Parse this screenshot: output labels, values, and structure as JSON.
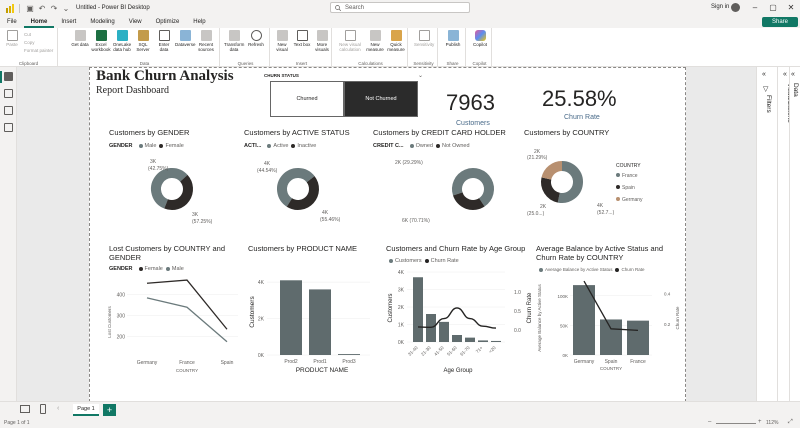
{
  "window": {
    "title": "Untitled - Power BI Desktop",
    "search_placeholder": "Search",
    "signin": "Sign in",
    "share": "Share"
  },
  "menu": [
    "File",
    "Home",
    "Insert",
    "Modeling",
    "View",
    "Optimize",
    "Help"
  ],
  "ribbon": {
    "clipboard": {
      "paste": "Paste",
      "cut": "Cut",
      "copy": "Copy",
      "format_painter": "Format painter",
      "label": "Clipboard"
    },
    "data": {
      "label": "Data",
      "buttons": [
        "Get data",
        "Excel workbook",
        "OneLake data hub",
        "SQL Server",
        "Enter data",
        "Dataverse",
        "Recent sources"
      ]
    },
    "queries": {
      "label": "Queries",
      "buttons": [
        "Transform data",
        "Refresh"
      ]
    },
    "insert": {
      "label": "Insert",
      "buttons": [
        "New visual",
        "Text box",
        "More visuals"
      ]
    },
    "calculations": {
      "label": "Calculations",
      "buttons": [
        "New visual calculation",
        "New measure",
        "Quick measure"
      ]
    },
    "sensitivity": {
      "label": "Sensitivity",
      "buttons": [
        "Sensitivity"
      ]
    },
    "share": {
      "label": "Share",
      "buttons": [
        "Publish"
      ]
    },
    "copilot": {
      "label": "Copilot",
      "buttons": [
        "Copilot"
      ]
    }
  },
  "report": {
    "title": "Bank Churn Analysis",
    "subtitle": "Report Dashboard",
    "slicer": {
      "label": "CHURN STATUS",
      "options": [
        "Churned",
        "Not Churned"
      ],
      "selected": "Not Churned"
    },
    "kpi_customers": {
      "value": "7963",
      "label": "Customers"
    },
    "kpi_churn": {
      "value": "25.58%",
      "label": "Churn Rate"
    }
  },
  "visuals": {
    "gender": {
      "title": "Customers by GENDER",
      "legend_title": "GENDER",
      "labels": [
        "3K",
        "(42.75%)",
        "3K",
        "(57.25%)"
      ]
    },
    "active": {
      "title": "Customers by ACTIVE STATUS",
      "legend_title": "ACTI...",
      "labels": [
        "4K",
        "(44.54%)",
        "4K",
        "(55.46%)"
      ]
    },
    "credit": {
      "title": "Customers by CREDIT CARD HOLDER",
      "legend_title": "CREDIT C...",
      "labels": [
        "2K (29.29%)",
        "6K (70.71%)"
      ]
    },
    "country": {
      "title": "Customers by COUNTRY",
      "legend_title": "COUNTRY",
      "labels": [
        "2K",
        "(21.29%)",
        "2K",
        "(25.0...)",
        "4K",
        "(52.7...)"
      ]
    },
    "lost": {
      "title": "Lost Customers by COUNTRY and GENDER",
      "legend_title": "GENDER",
      "ylabel": "Lost Customers",
      "xlabel": "COUNTRY"
    },
    "product": {
      "title": "Customers by PRODUCT NAME",
      "ylabel": "Customers",
      "xlabel": "PRODUCT NAME"
    },
    "age": {
      "title": "Customers and Churn Rate by Age Group",
      "legend": [
        "Customers",
        "Churn Rate"
      ],
      "ylabel": "Customers",
      "y2label": "Churn Rate",
      "xlabel": "Age Group"
    },
    "balance": {
      "title": "Average Balance by Active Status and Churn Rate by COUNTRY",
      "legend": [
        "Average Balance by Active Status",
        "Churn Rate"
      ],
      "ylabel": "Average Balance by Active Status",
      "y2label": "Churn Rate",
      "xlabel": "COUNTRY"
    }
  },
  "colors": {
    "male": "#6b7a7c",
    "female": "#2e2a28",
    "gray_dark": "#5f6b6d",
    "germany": "#b89070",
    "accent": "#117865"
  },
  "chart_data": [
    {
      "type": "pie",
      "title": "Customers by GENDER",
      "categories": [
        "Male",
        "Female"
      ],
      "values": [
        57.25,
        42.75
      ]
    },
    {
      "type": "pie",
      "title": "Customers by ACTIVE STATUS",
      "categories": [
        "Active",
        "Inactive"
      ],
      "values": [
        55.46,
        44.54
      ]
    },
    {
      "type": "pie",
      "title": "Customers by CREDIT CARD HOLDER",
      "categories": [
        "Owned",
        "Not Owned"
      ],
      "values": [
        70.71,
        29.29
      ]
    },
    {
      "type": "pie",
      "title": "Customers by COUNTRY",
      "categories": [
        "France",
        "Spain",
        "Germany"
      ],
      "values": [
        52.7,
        25.0,
        21.29
      ]
    },
    {
      "type": "line",
      "title": "Lost Customers by COUNTRY and GENDER",
      "categories": [
        "Germany",
        "France",
        "Spain"
      ],
      "series": [
        {
          "name": "Female",
          "values": [
            455,
            470,
            235
          ]
        },
        {
          "name": "Male",
          "values": [
            385,
            340,
            175
          ]
        }
      ],
      "ylim": [
        150,
        480
      ],
      "yticks": [
        200,
        300,
        400
      ],
      "ylabel": "Lost Customers",
      "xlabel": "COUNTRY"
    },
    {
      "type": "bar",
      "title": "Customers by PRODUCT NAME",
      "categories": [
        "Prod2",
        "Prod1",
        "Prod3"
      ],
      "values": [
        4100,
        3600,
        50
      ],
      "ylim": [
        0,
        4500
      ],
      "yticks": [
        "0K",
        "2K",
        "4K"
      ],
      "ylabel": "Customers",
      "xlabel": "PRODUCT NAME"
    },
    {
      "type": "bar",
      "title": "Customers and Churn Rate by Age Group",
      "categories": [
        "31-40",
        "21-30",
        "41-50",
        "51-60",
        "61-70",
        "71+",
        "<20"
      ],
      "series": [
        {
          "name": "Customers",
          "values": [
            3700,
            1600,
            1150,
            400,
            250,
            90,
            60
          ]
        },
        {
          "name": "Churn Rate",
          "values": [
            0.08,
            0.07,
            0.3,
            0.58,
            0.3,
            0.1,
            0.05
          ]
        }
      ],
      "ylim": [
        0,
        4000
      ],
      "yticks": [
        "0K",
        "1K",
        "2K",
        "3K",
        "4K"
      ],
      "y2ticks": [
        "0.0",
        "0.5",
        "1.0"
      ],
      "ylabel": "Customers",
      "y2label": "Churn Rate",
      "xlabel": "Age Group"
    },
    {
      "type": "bar",
      "title": "Average Balance by Active Status and Churn Rate by COUNTRY",
      "categories": [
        "Germany",
        "Spain",
        "France"
      ],
      "series": [
        {
          "name": "Average Balance by Active Status",
          "values": [
            118000,
            60000,
            58000
          ]
        },
        {
          "name": "Churn Rate",
          "values": [
            0.48,
            0.17,
            0.16
          ]
        }
      ],
      "ylim": [
        0,
        130000
      ],
      "yticks": [
        "0K",
        "50K",
        "100K"
      ],
      "y2ticks": [
        "0.2",
        "0.4"
      ],
      "ylabel": "Average Balance by Active Status",
      "y2label": "Churn Rate",
      "xlabel": "COUNTRY"
    }
  ],
  "panes": {
    "filters": "Filters",
    "visualizations": "Visualizations",
    "data": "Data"
  },
  "pages": {
    "tabs": [
      "Page 1"
    ],
    "add": "+",
    "status": "Page 1 of 1",
    "zoom": "112%"
  }
}
